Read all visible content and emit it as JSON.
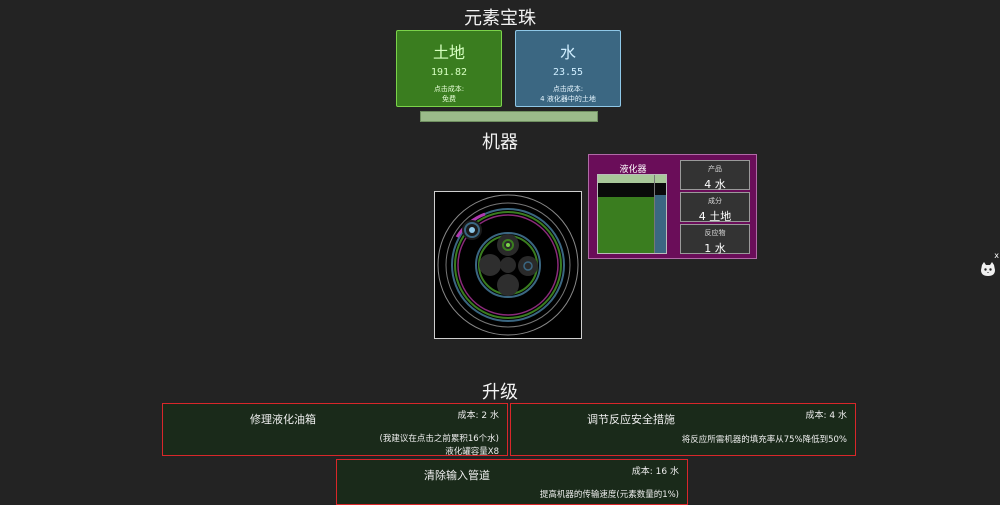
{
  "orbs_section": {
    "title": "元素宝珠"
  },
  "orbs": [
    {
      "name": "土地",
      "amount": "191.82",
      "cost_label": "点击成本:",
      "cost_value": "免费"
    },
    {
      "name": "水",
      "amount": "23.55",
      "cost_label": "点击成本:",
      "cost_value": "4 液化器中的土地"
    }
  ],
  "machines_section": {
    "title": "机器"
  },
  "machine": {
    "name": "液化器",
    "tank_fill": {
      "earth": 0.72,
      "water": 0.74
    },
    "product": {
      "label": "产品",
      "value": "4 水"
    },
    "ingredient": {
      "label": "成分",
      "value": "4 土地"
    },
    "reactant": {
      "label": "反应物",
      "value": "1 水"
    }
  },
  "side_widget": {
    "close": "x",
    "icon": "cat-face-icon"
  },
  "upgrades_section": {
    "title": "升级"
  },
  "upgrades": [
    {
      "name": "修理液化油箱",
      "cost": "成本: 2 水",
      "desc1": "(我建议在点击之前累积16个水)",
      "desc2": "液化罐容量X8"
    },
    {
      "name": "调节反应安全措施",
      "cost": "成本: 4 水",
      "desc1": "将反应所需机器的填充率从75%降低到50%"
    },
    {
      "name": "清除输入管道",
      "cost": "成本: 16 水",
      "desc1": "提高机器的传输速度(元素数量的1%)"
    }
  ],
  "colors": {
    "earth": "#3a7d1f",
    "water": "#3b6782",
    "machine_panel": "#6a0d59",
    "upgrade_border": "#d8272a"
  }
}
